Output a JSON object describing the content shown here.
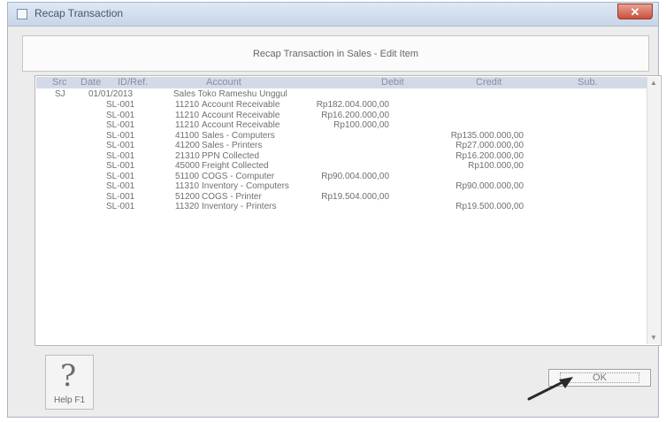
{
  "window": {
    "title": "Recap Transaction",
    "close_symbol": "✕"
  },
  "header": {
    "title": "Recap Transaction in Sales - Edit Item"
  },
  "grid": {
    "columns": [
      "Src",
      "Date",
      "ID/Ref.",
      "Account",
      "Debit",
      "Credit",
      "Sub."
    ],
    "summary_row": {
      "src": "SJ",
      "date": "01/01/2013",
      "description": "Sales Toko Rameshu Unggul"
    },
    "rows": [
      {
        "ref": "SL-001",
        "account_no": "11210",
        "account_name": "Account Receivable",
        "debit": "Rp182.004.000,00",
        "credit": ""
      },
      {
        "ref": "SL-001",
        "account_no": "11210",
        "account_name": "Account Receivable",
        "debit": "Rp16.200.000,00",
        "credit": ""
      },
      {
        "ref": "SL-001",
        "account_no": "11210",
        "account_name": "Account Receivable",
        "debit": "Rp100.000,00",
        "credit": ""
      },
      {
        "ref": "SL-001",
        "account_no": "41100",
        "account_name": "Sales - Computers",
        "debit": "",
        "credit": "Rp135.000.000,00"
      },
      {
        "ref": "SL-001",
        "account_no": "41200",
        "account_name": "Sales - Printers",
        "debit": "",
        "credit": "Rp27.000.000,00"
      },
      {
        "ref": "SL-001",
        "account_no": "21310",
        "account_name": "PPN Collected",
        "debit": "",
        "credit": "Rp16.200.000,00"
      },
      {
        "ref": "SL-001",
        "account_no": "45000",
        "account_name": "Freight Collected",
        "debit": "",
        "credit": "Rp100.000,00"
      },
      {
        "ref": "SL-001",
        "account_no": "51100",
        "account_name": "COGS - Computer",
        "debit": "Rp90.004.000,00",
        "credit": ""
      },
      {
        "ref": "SL-001",
        "account_no": "11310",
        "account_name": "Inventory - Computers",
        "debit": "",
        "credit": "Rp90.000.000,00"
      },
      {
        "ref": "SL-001",
        "account_no": "51200",
        "account_name": "COGS - Printer",
        "debit": "Rp19.504.000,00",
        "credit": ""
      },
      {
        "ref": "SL-001",
        "account_no": "11320",
        "account_name": "Inventory - Printers",
        "debit": "",
        "credit": "Rp19.500.000,00"
      }
    ]
  },
  "buttons": {
    "help_label": "Help F1",
    "help_symbol": "?",
    "ok_label": "OK"
  }
}
